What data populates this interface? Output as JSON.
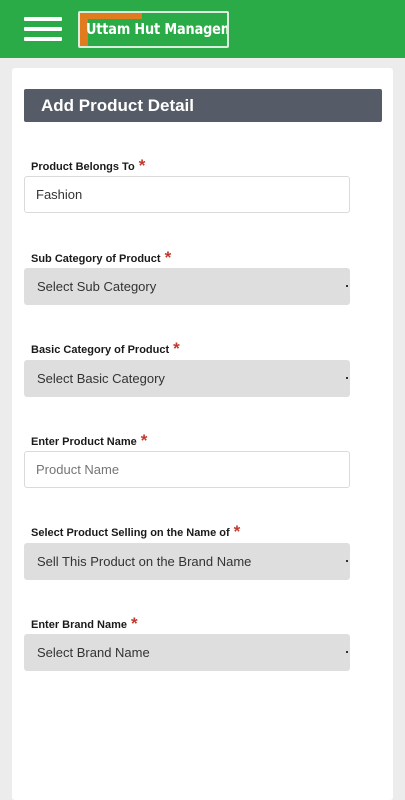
{
  "brand": {
    "logo_text": "Uttam Hut Management",
    "primary_color": "#2aab47",
    "accent_color": "#e07b1e"
  },
  "header": {
    "menu_icon": "hamburger-menu-icon"
  },
  "form": {
    "title": "Add Product Detail",
    "required_marker": "*",
    "fields": [
      {
        "label": "Product Belongs To",
        "type": "text",
        "value": "Fashion"
      },
      {
        "label": "Sub Category of Product",
        "type": "select",
        "value": "Select Sub Category"
      },
      {
        "label": "Basic Category of Product",
        "type": "select",
        "value": "Select Basic Category"
      },
      {
        "label": "Enter Product Name",
        "type": "text",
        "placeholder": "Product Name"
      },
      {
        "label": "Select Product Selling on the Name of",
        "type": "select",
        "value": "Sell This Product on the Brand Name"
      },
      {
        "label": "Enter Brand Name",
        "type": "select",
        "value": "Select Brand Name"
      }
    ]
  }
}
